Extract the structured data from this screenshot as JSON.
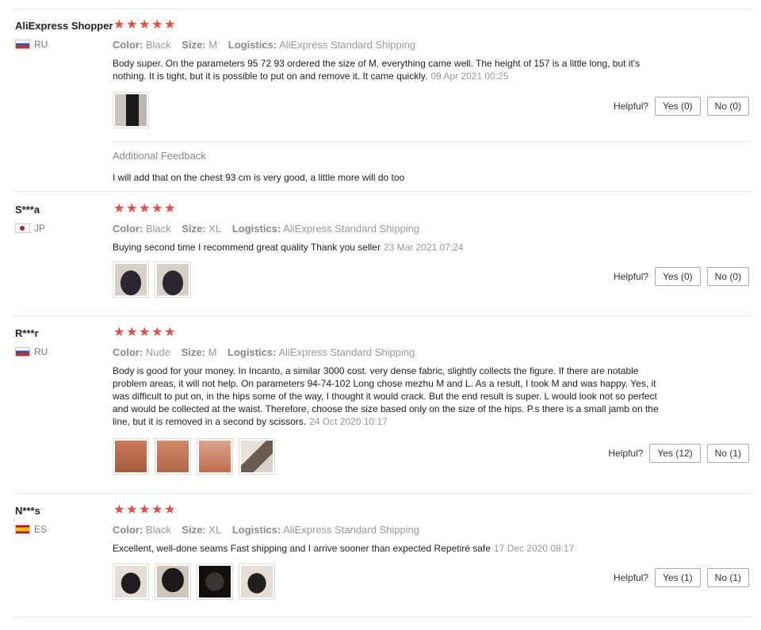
{
  "labels": {
    "color": "Color:",
    "size": "Size:",
    "logistics": "Logistics:",
    "helpful": "Helpful?",
    "additional_feedback": "Additional Feedback"
  },
  "colors": {
    "star": "#f14840",
    "border": "#e6e6e6"
  },
  "reviews": [
    {
      "user": "AliExpress Shopper",
      "country": "RU",
      "flag": "ru-flag-icon",
      "rating": 5,
      "color": "Black",
      "size": "M",
      "logistics": "AliExpress Standard Shipping",
      "text": "Body super. On the parameters 95 72 93 ordered the size of M, everything came well. The height of 157 is a little long, but it's nothing. It is tight, but it is possible to put on and remove it. It came quickly.",
      "date": "09 Apr 2021 00:25",
      "yes": "Yes (0)",
      "no": "No (0)",
      "additional_feedback": "I will add that on the chest 93 cm is very good, a little more will do too"
    },
    {
      "user": "S***a",
      "country": "JP",
      "flag": "jp-flag-icon",
      "rating": 5,
      "color": "Black",
      "size": "XL",
      "logistics": "AliExpress Standard Shipping",
      "text": "Buying second time I recommend great quality Thank you seller",
      "date": "23 Mar 2021 07:24",
      "yes": "Yes (0)",
      "no": "No (0)"
    },
    {
      "user": "R***r",
      "country": "RU",
      "flag": "ru-flag-icon",
      "rating": 5,
      "color": "Nude",
      "size": "M",
      "logistics": "AliExpress Standard Shipping",
      "text": "Body is good for your money. In Incanto, a similar 3000 cost. very dense fabric, slightly collects the figure. If there are notable problem areas, it will not help. On parameters 94-74-102 Long chose mezhu M and L. As a result, I took M and was happy. Yes, it was difficult to put on, in the hips some of the way, I thought it would crack. But the end result is super. L would look not so perfect and would be collected at the waist. Therefore, choose the size based only on the size of the hips. P.s there is a small jamb on the line, but it is removed in a second by scissors.",
      "date": "24 Oct 2020 10:17",
      "yes": "Yes (12)",
      "no": "No (1)"
    },
    {
      "user": "N***s",
      "country": "ES",
      "flag": "es-flag-icon",
      "rating": 5,
      "color": "Black",
      "size": "XL",
      "logistics": "AliExpress Standard Shipping",
      "text": "Excellent, well-done seams Fast shipping and I arrive sooner than expected Repetiré safe",
      "date": "17 Dec 2020 08:17",
      "yes": "Yes (1)",
      "no": "No (1)"
    }
  ]
}
